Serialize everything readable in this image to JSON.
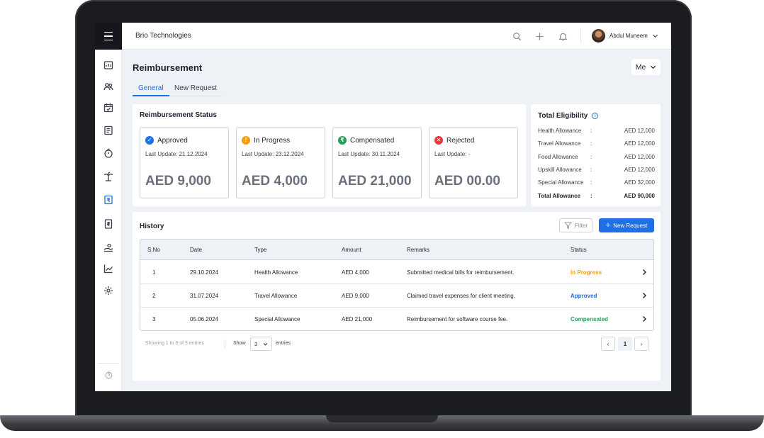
{
  "app": {
    "company": "Brio Technologies",
    "user": "Abdul Muneem"
  },
  "page": {
    "title": "Reimbursement",
    "view_selector": "Me",
    "tabs": [
      {
        "label": "General",
        "active": true
      },
      {
        "label": "New Request",
        "active": false
      }
    ]
  },
  "status_card": {
    "title": "Reimbursement Status",
    "items": [
      {
        "label": "Approved",
        "update": "Last Update: 21.12.2024",
        "amount": "AED 9,000",
        "color": "#1f6fe5",
        "icon": "check-icon"
      },
      {
        "label": "In Progress",
        "update": "Last Update: 23.12.2024",
        "amount": "AED 4,000",
        "color": "#f59e0b",
        "icon": "exclamation-icon"
      },
      {
        "label": "Compensated",
        "update": "Last Update: 30.11.2024",
        "amount": "AED 21,000",
        "color": "#22a05a",
        "icon": "rupee-icon"
      },
      {
        "label": "Rejected",
        "update": "Last Update: -",
        "amount": "AED 00.00",
        "color": "#e5383b",
        "icon": "x-icon"
      }
    ]
  },
  "eligibility": {
    "title": "Total Eligibility",
    "rows": [
      {
        "label": "Health Allowance",
        "sep": ":",
        "value": "AED 12,000"
      },
      {
        "label": "Travel Allowance",
        "sep": ":",
        "value": "AED 12,000"
      },
      {
        "label": "Food Allowance",
        "sep": ":",
        "value": "AED 12,000"
      },
      {
        "label": "Upskill Allowance",
        "sep": ":",
        "value": "AED 12,000"
      },
      {
        "label": "Special Allowance",
        "sep": ":",
        "value": "AED 32,000"
      },
      {
        "label": "Total Allowance",
        "sep": ":",
        "value": "AED 90,000"
      }
    ]
  },
  "history": {
    "title": "History",
    "filter_label": "Filter",
    "new_request_label": "New Request",
    "columns": [
      "S.No",
      "Date",
      "Type",
      "Amount",
      "Remarks",
      "Status"
    ],
    "rows": [
      {
        "sno": "1",
        "date": "29.10.2024",
        "type": "Health Allowance",
        "amount": "AED 4,000",
        "remarks": "Submitted medical bills for reimbursement.",
        "status": "In Progress",
        "status_color": "#f59e0b"
      },
      {
        "sno": "2",
        "date": "31.07.2024",
        "type": "Travel Allowance",
        "amount": "AED 9,000",
        "remarks": "Claimed travel expenses for client meeting.",
        "status": "Approved",
        "status_color": "#1f6fe5"
      },
      {
        "sno": "3",
        "date": "05.06.2024",
        "type": "Special Allowance",
        "amount": "AED 21,000",
        "remarks": "Reimbursement for software course fee.",
        "status": "Compensated",
        "status_color": "#22a05a"
      }
    ],
    "footer": {
      "info": "Showing 1 to 3 of 3 entries",
      "show_label": "Show",
      "page_size": "3",
      "entries_label": "entries",
      "prev": "‹",
      "current_page": "1",
      "next": "›"
    }
  }
}
